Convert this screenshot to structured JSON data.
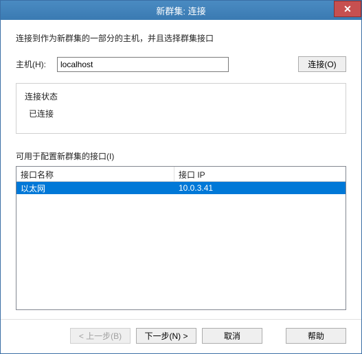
{
  "window": {
    "title": "新群集: 连接"
  },
  "instruction": "连接到作为新群集的一部分的主机，并且选择群集接口",
  "host": {
    "label": "主机(H):",
    "value": "localhost"
  },
  "connect_btn": "连接(O)",
  "status": {
    "title": "连接状态",
    "value": "已连接"
  },
  "interfaces_label": "可用于配置新群集的接口(I)",
  "listview": {
    "headers": {
      "name": "接口名称",
      "ip": "接口 IP"
    },
    "rows": [
      {
        "name": "以太网",
        "ip": "10.0.3.41",
        "selected": true
      }
    ]
  },
  "buttons": {
    "back": "< 上一步(B)",
    "next": "下一步(N) >",
    "cancel": "取消",
    "help": "帮助"
  }
}
